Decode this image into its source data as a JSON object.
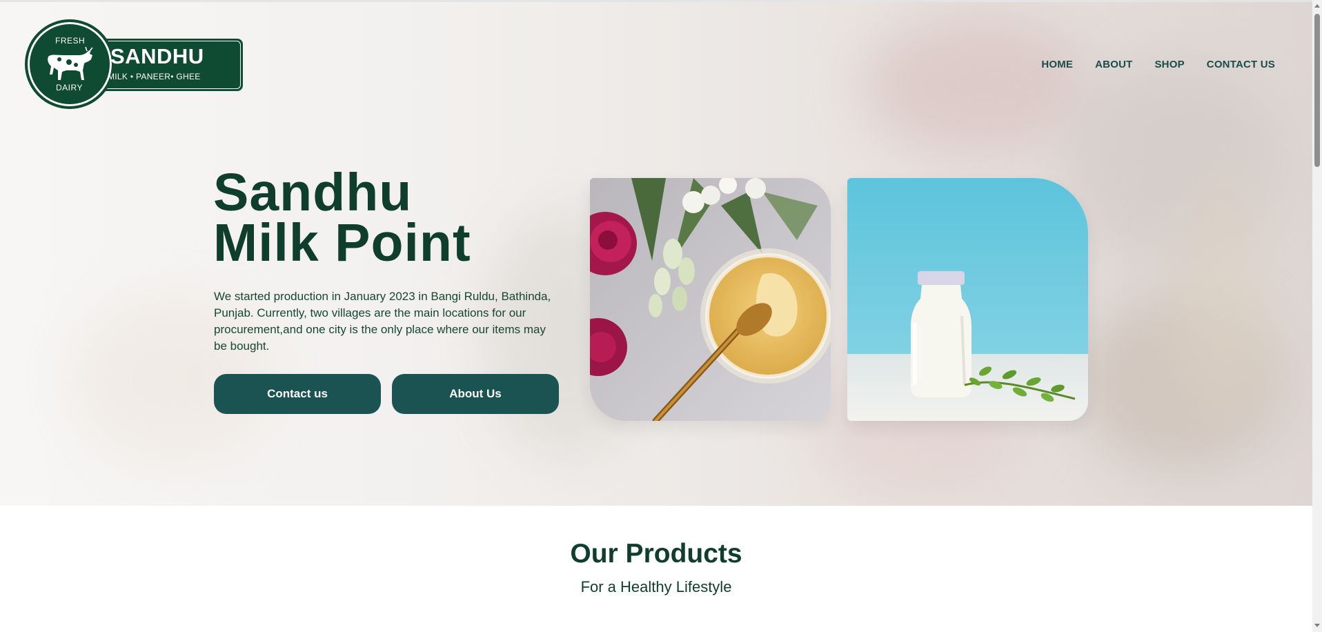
{
  "logo": {
    "top_text": "FRESH",
    "bottom_text": "DAIRY",
    "brand": "SANDHU",
    "tagline": "MILK • PANEER• GHEE"
  },
  "nav": {
    "items": [
      {
        "label": "HOME"
      },
      {
        "label": "ABOUT"
      },
      {
        "label": "SHOP"
      },
      {
        "label": "CONTACT US"
      }
    ]
  },
  "hero": {
    "title_line1": "Sandhu",
    "title_line2": "Milk Point",
    "description": "We started production in January 2023 in Bangi Ruldu, Bathinda, Punjab. Currently, two villages are the main locations for our procurement,and one city is the only place where our items may be bought.",
    "contact_button": "Contact us",
    "about_button": "About Us"
  },
  "products": {
    "title": "Our Products",
    "subtitle": "For a Healthy Lifestyle"
  },
  "colors": {
    "brand_green": "#0f4a32",
    "button_teal": "#1b5252",
    "heading_green": "#0f3d2e"
  }
}
